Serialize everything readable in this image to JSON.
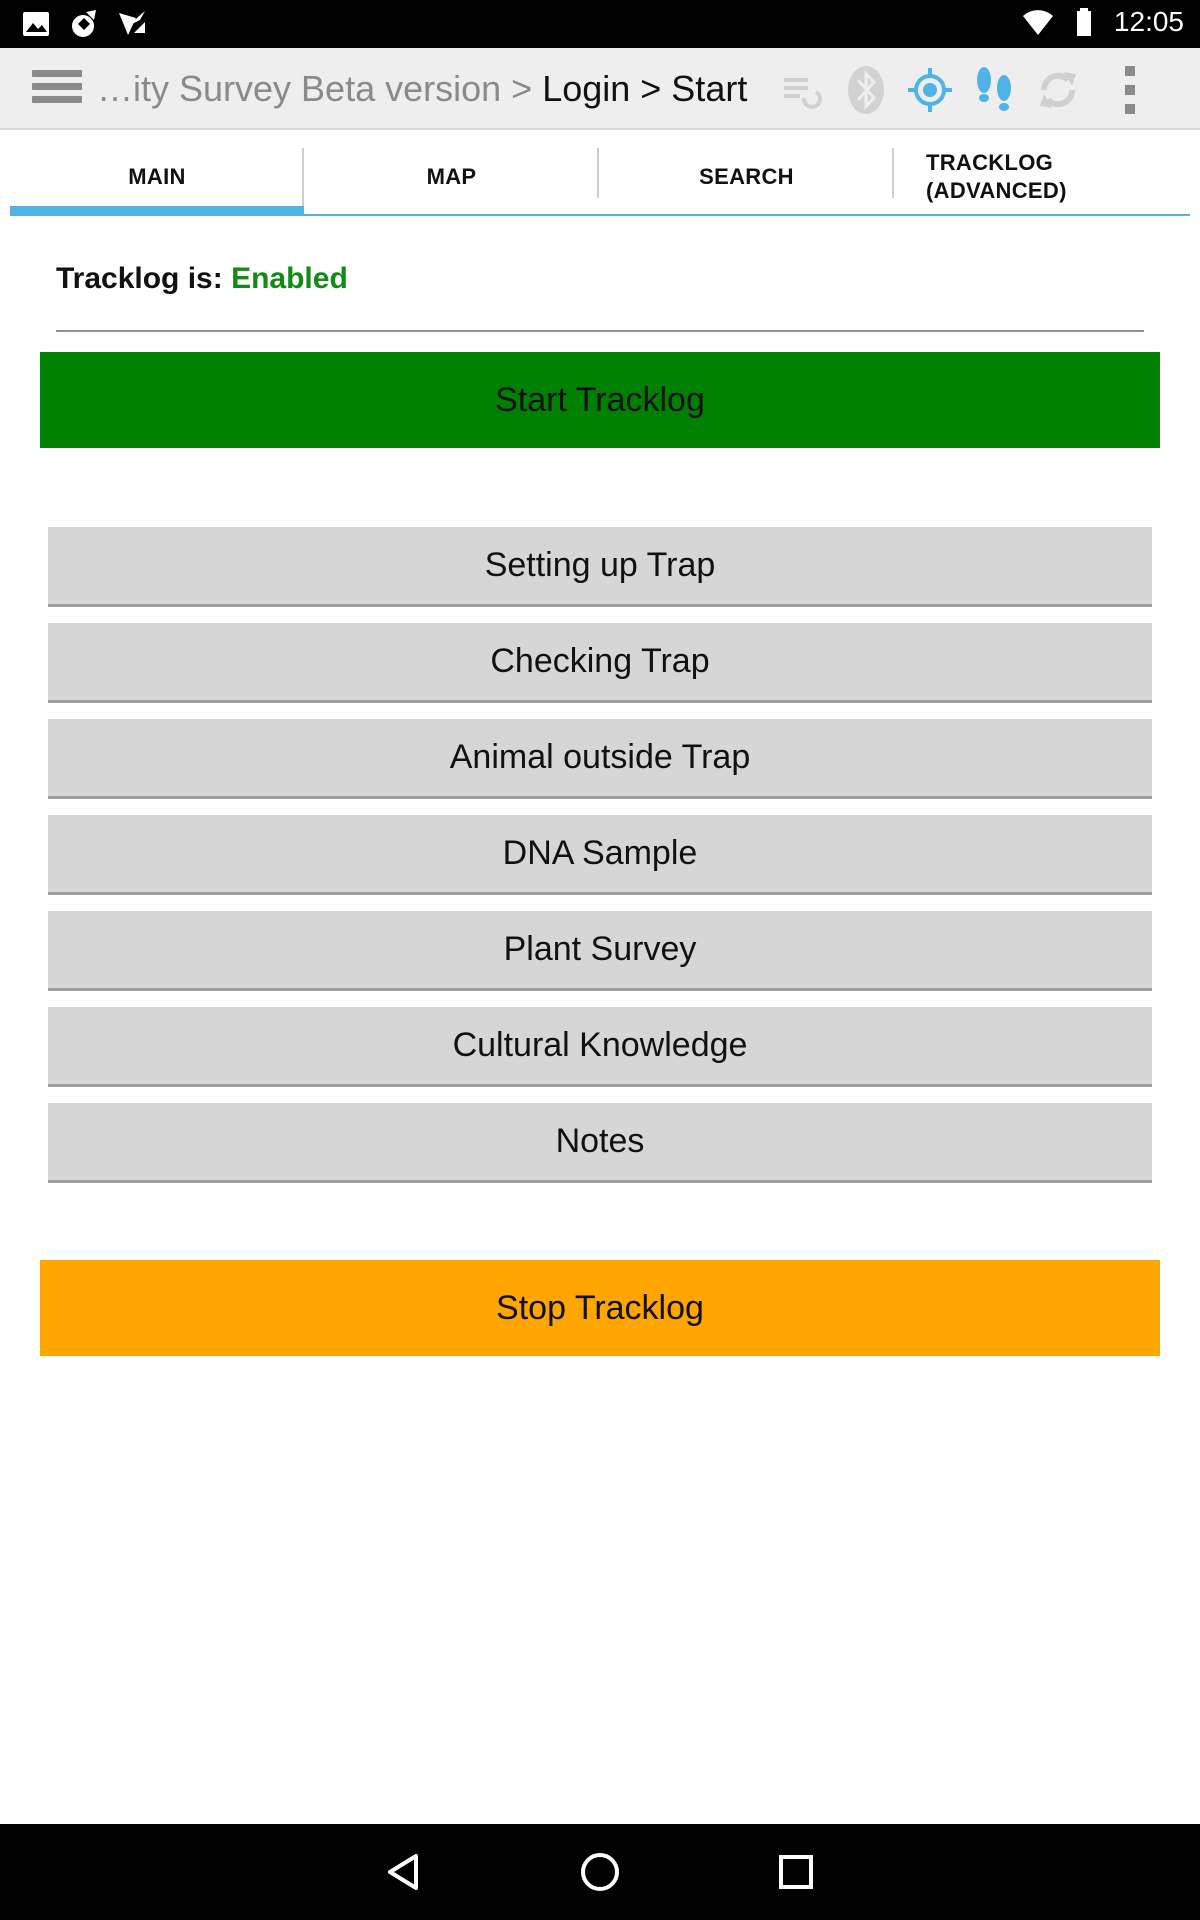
{
  "status_bar": {
    "time": "12:05",
    "left_icons": [
      "image-notification-icon",
      "app-notification-icon",
      "download-notification-icon"
    ],
    "right_icons": [
      "wifi-icon",
      "battery-icon"
    ]
  },
  "action_bar": {
    "breadcrumb_prefix": "…ity Survey Beta version > ",
    "breadcrumb_current": "Login > Start",
    "icons": [
      "sync-forms-icon",
      "bluetooth-icon",
      "gps-location-icon",
      "footsteps-tracklog-icon",
      "refresh-icon",
      "overflow-menu-icon"
    ],
    "colors": {
      "active_icon": "#4fb3e8",
      "disabled_icon": "#c8c8c8"
    }
  },
  "tabs": [
    {
      "label": "MAIN",
      "active": true
    },
    {
      "label": "MAP",
      "active": false
    },
    {
      "label": "SEARCH",
      "active": false
    },
    {
      "label": "TRACKLOG (ADVANCED)",
      "line1": "TRACKLOG",
      "line2": "(ADVANCED)",
      "active": false
    }
  ],
  "main": {
    "status_label": "Tracklog is:",
    "status_value": "Enabled",
    "status_color": "#138a13",
    "start_button": "Start Tracklog",
    "start_color": "#008000",
    "buttons": [
      "Setting up Trap",
      "Checking Trap",
      "Animal outside Trap",
      "DNA Sample",
      "Plant Survey",
      "Cultural Knowledge",
      "Notes"
    ],
    "stop_button": "Stop Tracklog",
    "stop_color": "#ffa500"
  },
  "nav_bar": {
    "buttons": [
      "back-icon",
      "home-icon",
      "recents-icon"
    ]
  }
}
